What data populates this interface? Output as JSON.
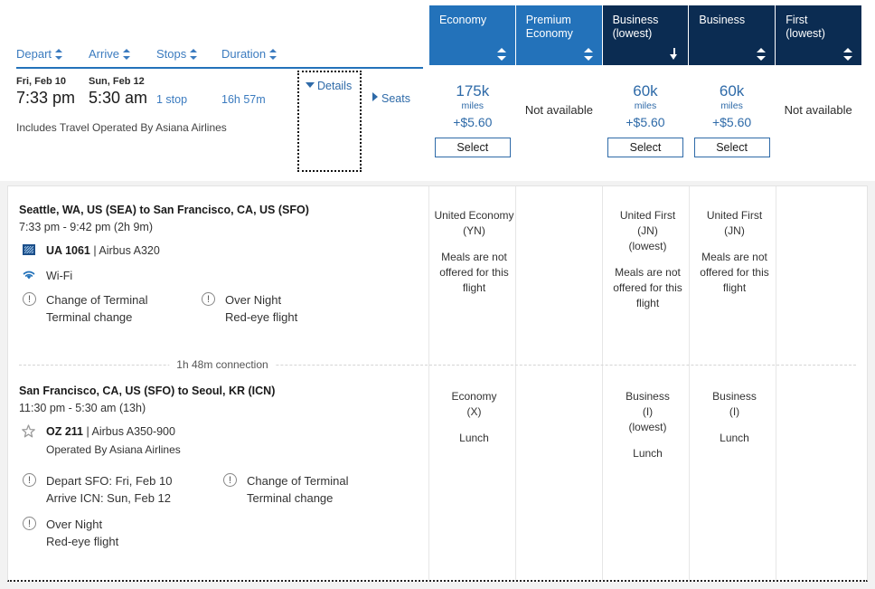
{
  "fare_columns": [
    {
      "label_line1": "Economy",
      "label_line2": "",
      "theme": "light",
      "sort": "both"
    },
    {
      "label_line1": "Premium",
      "label_line2": "Economy",
      "theme": "light",
      "sort": "both"
    },
    {
      "label_line1": "Business",
      "label_line2": "(lowest)",
      "theme": "dark",
      "sort": "desc"
    },
    {
      "label_line1": "Business",
      "label_line2": "",
      "theme": "dark",
      "sort": "both"
    },
    {
      "label_line1": "First",
      "label_line2": "(lowest)",
      "theme": "dark",
      "sort": "both"
    }
  ],
  "sort_bar": {
    "depart": "Depart",
    "arrive": "Arrive",
    "stops": "Stops",
    "duration": "Duration"
  },
  "summary": {
    "depart_date": "Fri, Feb 10",
    "depart_time": "7:33 pm",
    "arrive_date": "Sun, Feb 12",
    "arrive_time": "5:30 am",
    "stops": "1 stop",
    "duration": "16h 57m",
    "details_label": "Details",
    "seats_label": "Seats",
    "operated_note": "Includes Travel Operated By Asiana Airlines"
  },
  "fares": [
    {
      "available": true,
      "miles": "175k",
      "unit": "miles",
      "tax": "+$5.60",
      "select_label": "Select",
      "unavailable_label": ""
    },
    {
      "available": false,
      "miles": "",
      "unit": "",
      "tax": "",
      "select_label": "",
      "unavailable_label": "Not available"
    },
    {
      "available": true,
      "miles": "60k",
      "unit": "miles",
      "tax": "+$5.60",
      "select_label": "Select",
      "unavailable_label": ""
    },
    {
      "available": true,
      "miles": "60k",
      "unit": "miles",
      "tax": "+$5.60",
      "select_label": "Select",
      "unavailable_label": ""
    },
    {
      "available": false,
      "miles": "",
      "unit": "",
      "tax": "",
      "select_label": "",
      "unavailable_label": "Not available"
    }
  ],
  "segment1": {
    "route": "Seattle, WA, US (SEA) to San Francisco, CA, US (SFO)",
    "times": "7:33 pm - 9:42 pm (2h 9m)",
    "flight_number": "UA 1061",
    "separator": "|",
    "aircraft": "Airbus A320",
    "amenity": "Wi-Fi",
    "note1_line1": "Change of Terminal",
    "note1_line2": "Terminal change",
    "note2_line1": "Over Night",
    "note2_line2": "Red-eye flight",
    "fare_details": [
      {
        "line1": "United Economy",
        "line2": "(YN)",
        "line3": "",
        "meal": "Meals are not offered for this flight"
      },
      {
        "line1": "",
        "line2": "",
        "line3": "",
        "meal": ""
      },
      {
        "line1": "United First",
        "line2": "(JN)",
        "line3": "(lowest)",
        "meal": "Meals are not offered for this flight"
      },
      {
        "line1": "United First",
        "line2": "(JN)",
        "line3": "",
        "meal": "Meals are not offered for this flight"
      },
      {
        "line1": "",
        "line2": "",
        "line3": "",
        "meal": ""
      }
    ]
  },
  "connection": {
    "label": "1h 48m connection"
  },
  "segment2": {
    "route": "San Francisco, CA, US (SFO) to Seoul, KR (ICN)",
    "times": "11:30 pm - 5:30 am (13h)",
    "flight_number": "OZ 211",
    "separator": "|",
    "aircraft": "Airbus A350-900",
    "operated_by": "Operated By Asiana Airlines",
    "note1_line1": "Depart SFO: Fri, Feb 10",
    "note1_line2": "Arrive ICN: Sun, Feb 12",
    "note2_line1": "Change of Terminal",
    "note2_line2": "Terminal change",
    "note3_line1": "Over Night",
    "note3_line2": "Red-eye flight",
    "fare_details": [
      {
        "line1": "Economy",
        "line2": "(X)",
        "line3": "",
        "meal": "Lunch"
      },
      {
        "line1": "",
        "line2": "",
        "line3": "",
        "meal": ""
      },
      {
        "line1": "Business",
        "line2": "(I)",
        "line3": "(lowest)",
        "meal": "Lunch"
      },
      {
        "line1": "Business",
        "line2": "(I)",
        "line3": "",
        "meal": "Lunch"
      },
      {
        "line1": "",
        "line2": "",
        "line3": "",
        "meal": ""
      }
    ]
  },
  "icons": {
    "star": "☆",
    "wifi": "◞",
    "bang": "!"
  },
  "colors": {
    "tab_light": "#2372ba",
    "tab_dark": "#0b2c52",
    "link": "#2e6aa8",
    "rule": "#2372ba"
  }
}
